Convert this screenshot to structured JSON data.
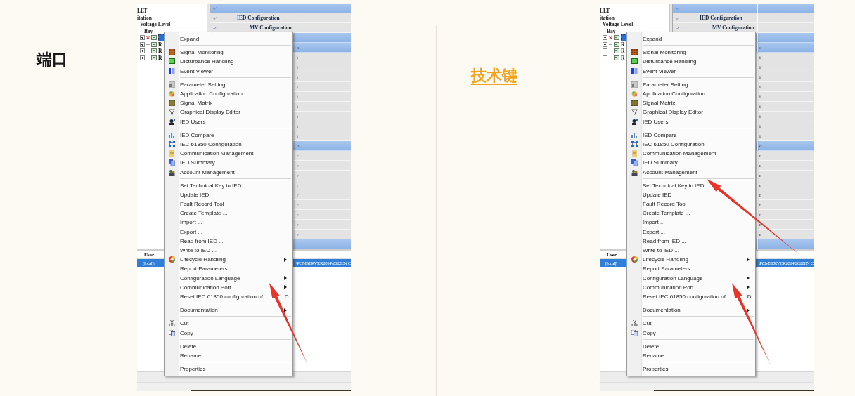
{
  "panels": [
    {
      "heading": {
        "text": "端口",
        "kind": "plain"
      },
      "arrows": [
        {
          "kind": "from-bottom"
        }
      ],
      "screenshot": {
        "tree": [
          {
            "label": "LLT"
          },
          {
            "label": "itation",
            "children": [
              {
                "label": "Voltage Level",
                "children": [
                  {
                    "label": "Bay",
                    "children": [
                      {
                        "error": true,
                        "selected": true
                      },
                      {
                        "label": "R",
                        "error": false,
                        "selected": false
                      },
                      {
                        "label": "R",
                        "error": false,
                        "selected": false
                      },
                      {
                        "label": "R",
                        "error": false,
                        "selected": false
                      }
                    ]
                  }
                ]
              }
            ]
          }
        ],
        "grid_rows": [
          {
            "kind": "group"
          },
          {
            "kind": "header",
            "label": "IED Configuration"
          },
          {
            "kind": "subheader",
            "label": "MV Configuration"
          },
          {
            "kind": "group"
          },
          {
            "kind": "group",
            "cell": "o"
          },
          {
            "kind": "data",
            "cell": "i"
          },
          {
            "kind": "data",
            "cell": "i"
          },
          {
            "kind": "data",
            "cell": "i"
          },
          {
            "kind": "data",
            "cell": "i"
          },
          {
            "kind": "data",
            "cell": "i"
          },
          {
            "kind": "data",
            "cell": "i"
          },
          {
            "kind": "data",
            "cell": "i"
          },
          {
            "kind": "data",
            "cell": "i"
          },
          {
            "kind": "data",
            "cell": "i"
          },
          {
            "kind": "group",
            "cell": "o"
          },
          {
            "kind": "data",
            "cell": "r"
          },
          {
            "kind": "data",
            "cell": "r"
          },
          {
            "kind": "data",
            "cell": "r"
          },
          {
            "kind": "data",
            "cell": "r"
          },
          {
            "kind": "data",
            "cell": "r"
          },
          {
            "kind": "data",
            "cell": "r"
          },
          {
            "kind": "data",
            "cell": "r"
          },
          {
            "kind": "data",
            "cell": "r"
          },
          {
            "kind": "data",
            "cell": "r"
          },
          {
            "kind": "group"
          }
        ],
        "log": {
          "column": "User",
          "row": {
            "selected": true,
            "left": "[local]\\",
            "right": "\\PCMSERVER2014\\2022EN C"
          }
        },
        "menu": [
          {
            "kind": "item",
            "label": "Expand",
            "icon": false,
            "submenu": false
          },
          {
            "kind": "separator"
          },
          {
            "kind": "item",
            "label": "Signal Monitoring",
            "icon": true,
            "submenu": false
          },
          {
            "kind": "item",
            "label": "Disturbance Handling",
            "icon": true,
            "submenu": false
          },
          {
            "kind": "item",
            "label": "Event Viewer",
            "icon": true,
            "submenu": false
          },
          {
            "kind": "separator"
          },
          {
            "kind": "item",
            "label": "Parameter Setting",
            "icon": true,
            "submenu": false
          },
          {
            "kind": "item",
            "label": "Application Configuration",
            "icon": true,
            "submenu": false
          },
          {
            "kind": "item",
            "label": "Signal Matrix",
            "icon": true,
            "submenu": false
          },
          {
            "kind": "item",
            "label": "Graphical Display Editor",
            "icon": true,
            "submenu": false
          },
          {
            "kind": "item",
            "label": "IED Users",
            "icon": true,
            "submenu": false
          },
          {
            "kind": "separator"
          },
          {
            "kind": "item",
            "label": "IED Compare",
            "icon": true,
            "submenu": false
          },
          {
            "kind": "item",
            "label": "IEC 61850 Configuration",
            "icon": true,
            "submenu": false
          },
          {
            "kind": "item",
            "label": "Communication Management",
            "icon": true,
            "submenu": false
          },
          {
            "kind": "item",
            "label": "IED Summary",
            "icon": true,
            "submenu": false
          },
          {
            "kind": "item",
            "label": "Account Management",
            "icon": true,
            "submenu": false
          },
          {
            "kind": "separator"
          },
          {
            "kind": "item",
            "label": "Set Technical Key in IED ...",
            "icon": false,
            "submenu": false
          },
          {
            "kind": "item",
            "label": "Update IED",
            "icon": false,
            "submenu": false
          },
          {
            "kind": "item",
            "label": "Fault Record Tool",
            "icon": false,
            "submenu": false
          },
          {
            "kind": "item",
            "label": "Create Template ...",
            "icon": false,
            "submenu": false
          },
          {
            "kind": "item",
            "label": "Import ...",
            "icon": false,
            "submenu": false
          },
          {
            "kind": "item",
            "label": "Export ...",
            "icon": false,
            "submenu": false
          },
          {
            "kind": "item",
            "label": "Read from IED ...",
            "icon": false,
            "submenu": false
          },
          {
            "kind": "item",
            "label": "Write to IED ...",
            "icon": false,
            "submenu": false
          },
          {
            "kind": "item",
            "label": "Lifecycle Handling",
            "icon": true,
            "submenu": true
          },
          {
            "kind": "item",
            "label": "Report Parameters...",
            "icon": false,
            "submenu": false
          },
          {
            "kind": "item",
            "label": "Configuration Language",
            "icon": false,
            "submenu": true
          },
          {
            "kind": "item",
            "label": "Communication Port",
            "icon": false,
            "submenu": true
          },
          {
            "kind": "item",
            "label": "Reset IEC 61850 configuration of",
            "label_after_arrow": "D...",
            "icon": false,
            "submenu": false
          },
          {
            "kind": "separator"
          },
          {
            "kind": "item",
            "label": "Documentation",
            "icon": false,
            "submenu": true
          },
          {
            "kind": "separator"
          },
          {
            "kind": "item",
            "label": "Cut",
            "icon": true,
            "submenu": false
          },
          {
            "kind": "item",
            "label": "Copy",
            "icon": true,
            "submenu": false
          },
          {
            "kind": "separator"
          },
          {
            "kind": "item",
            "label": "Delete",
            "icon": false,
            "submenu": false
          },
          {
            "kind": "item",
            "label": "Rename",
            "icon": false,
            "submenu": false
          },
          {
            "kind": "separator"
          },
          {
            "kind": "item",
            "label": "Properties",
            "icon": false,
            "submenu": false
          }
        ]
      }
    },
    {
      "heading": {
        "text": "技术键",
        "kind": "link"
      },
      "arrows": [
        {
          "kind": "from-right"
        },
        {
          "kind": "from-bottom"
        }
      ],
      "screenshot": {
        "tree": [
          {
            "label": "LLT"
          },
          {
            "label": "itation",
            "children": [
              {
                "label": "Voltage Level",
                "children": [
                  {
                    "label": "Bay",
                    "children": [
                      {
                        "error": true,
                        "selected": true
                      },
                      {
                        "label": "R",
                        "error": false,
                        "selected": false
                      },
                      {
                        "label": "R",
                        "error": false,
                        "selected": false
                      },
                      {
                        "label": "R",
                        "error": false,
                        "selected": false
                      }
                    ]
                  }
                ]
              }
            ]
          }
        ],
        "grid_rows": [
          {
            "kind": "group"
          },
          {
            "kind": "header",
            "label": "IED Configuration"
          },
          {
            "kind": "subheader",
            "label": "MV Configuration"
          },
          {
            "kind": "group"
          },
          {
            "kind": "group",
            "cell": "o"
          },
          {
            "kind": "data",
            "cell": "i"
          },
          {
            "kind": "data",
            "cell": "i"
          },
          {
            "kind": "data",
            "cell": "i"
          },
          {
            "kind": "data",
            "cell": "i"
          },
          {
            "kind": "data",
            "cell": "i"
          },
          {
            "kind": "data",
            "cell": "i"
          },
          {
            "kind": "data",
            "cell": "i"
          },
          {
            "kind": "data",
            "cell": "i"
          },
          {
            "kind": "data",
            "cell": "i"
          },
          {
            "kind": "group",
            "cell": "o"
          },
          {
            "kind": "data",
            "cell": "r"
          },
          {
            "kind": "data",
            "cell": "r"
          },
          {
            "kind": "data",
            "cell": "r"
          },
          {
            "kind": "data",
            "cell": "r"
          },
          {
            "kind": "data",
            "cell": "r"
          },
          {
            "kind": "data",
            "cell": "r"
          },
          {
            "kind": "data",
            "cell": "r"
          },
          {
            "kind": "data",
            "cell": "r"
          },
          {
            "kind": "data",
            "cell": "r"
          },
          {
            "kind": "group"
          }
        ],
        "log": {
          "column": "User",
          "row": {
            "selected": true,
            "left": "[local]\\",
            "right": "\\PCMSERVER2014\\2022EN C"
          }
        },
        "menu": [
          {
            "kind": "item",
            "label": "Expand",
            "icon": false,
            "submenu": false
          },
          {
            "kind": "separator"
          },
          {
            "kind": "item",
            "label": "Signal Monitoring",
            "icon": true,
            "submenu": false
          },
          {
            "kind": "item",
            "label": "Disturbance Handling",
            "icon": true,
            "submenu": false
          },
          {
            "kind": "item",
            "label": "Event Viewer",
            "icon": true,
            "submenu": false
          },
          {
            "kind": "separator"
          },
          {
            "kind": "item",
            "label": "Parameter Setting",
            "icon": true,
            "submenu": false
          },
          {
            "kind": "item",
            "label": "Application Configuration",
            "icon": true,
            "submenu": false
          },
          {
            "kind": "item",
            "label": "Signal Matrix",
            "icon": true,
            "submenu": false
          },
          {
            "kind": "item",
            "label": "Graphical Display Editor",
            "icon": true,
            "submenu": false
          },
          {
            "kind": "item",
            "label": "IED Users",
            "icon": true,
            "submenu": false
          },
          {
            "kind": "separator"
          },
          {
            "kind": "item",
            "label": "IED Compare",
            "icon": true,
            "submenu": false
          },
          {
            "kind": "item",
            "label": "IEC 61850 Configuration",
            "icon": true,
            "submenu": false
          },
          {
            "kind": "item",
            "label": "Communication Management",
            "icon": true,
            "submenu": false
          },
          {
            "kind": "item",
            "label": "IED Summary",
            "icon": true,
            "submenu": false
          },
          {
            "kind": "item",
            "label": "Account Management",
            "icon": true,
            "submenu": false
          },
          {
            "kind": "separator"
          },
          {
            "kind": "item",
            "label": "Set Technical Key in IED ...",
            "icon": false,
            "submenu": false
          },
          {
            "kind": "item",
            "label": "Update IED",
            "icon": false,
            "submenu": false
          },
          {
            "kind": "item",
            "label": "Fault Record Tool",
            "icon": false,
            "submenu": false
          },
          {
            "kind": "item",
            "label": "Create Template ...",
            "icon": false,
            "submenu": false
          },
          {
            "kind": "item",
            "label": "Import ...",
            "icon": false,
            "submenu": false
          },
          {
            "kind": "item",
            "label": "Export ...",
            "icon": false,
            "submenu": false
          },
          {
            "kind": "item",
            "label": "Read from IED ...",
            "icon": false,
            "submenu": false
          },
          {
            "kind": "item",
            "label": "Write to IED ...",
            "icon": false,
            "submenu": false
          },
          {
            "kind": "item",
            "label": "Lifecycle Handling",
            "icon": true,
            "submenu": true
          },
          {
            "kind": "item",
            "label": "Report Parameters...",
            "icon": false,
            "submenu": false
          },
          {
            "kind": "item",
            "label": "Configuration Language",
            "icon": false,
            "submenu": true
          },
          {
            "kind": "item",
            "label": "Communication Port",
            "icon": false,
            "submenu": true
          },
          {
            "kind": "item",
            "label": "Reset IEC 61850 configuration of",
            "label_after_arrow": "D...",
            "icon": false,
            "submenu": false
          },
          {
            "kind": "separator"
          },
          {
            "kind": "item",
            "label": "Documentation",
            "icon": false,
            "submenu": true
          },
          {
            "kind": "separator"
          },
          {
            "kind": "item",
            "label": "Cut",
            "icon": true,
            "submenu": false
          },
          {
            "kind": "item",
            "label": "Copy",
            "icon": true,
            "submenu": false
          },
          {
            "kind": "separator"
          },
          {
            "kind": "item",
            "label": "Delete",
            "icon": false,
            "submenu": false
          },
          {
            "kind": "item",
            "label": "Rename",
            "icon": false,
            "submenu": false
          },
          {
            "kind": "separator"
          },
          {
            "kind": "item",
            "label": "Properties",
            "icon": false,
            "submenu": false
          }
        ]
      }
    }
  ]
}
